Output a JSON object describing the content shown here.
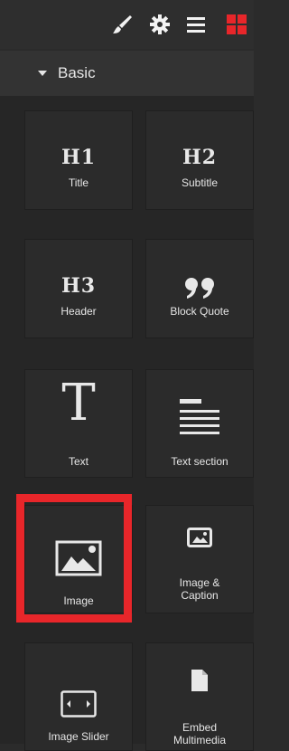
{
  "toolbar": {
    "icons": [
      "brush-icon",
      "gear-icon",
      "menu-icon",
      "grid-icon"
    ],
    "accent": "#e8262a"
  },
  "section": {
    "label": "Basic"
  },
  "tiles": [
    {
      "glyph": "H1",
      "label": "Title"
    },
    {
      "glyph": "H2",
      "label": "Subtitle"
    },
    {
      "glyph": "H3",
      "label": "Header"
    },
    {
      "glyph": "99",
      "label": "Block Quote"
    },
    {
      "glyph": "T",
      "label": "Text"
    },
    {
      "glyph": "",
      "label": "Text section"
    },
    {
      "glyph": "",
      "label": "Image",
      "selected": true
    },
    {
      "glyph": "",
      "label": "Image &\nCaption"
    },
    {
      "glyph": "",
      "label": "Image Slider"
    },
    {
      "glyph": "",
      "label": "Embed\nMultimedia"
    }
  ]
}
